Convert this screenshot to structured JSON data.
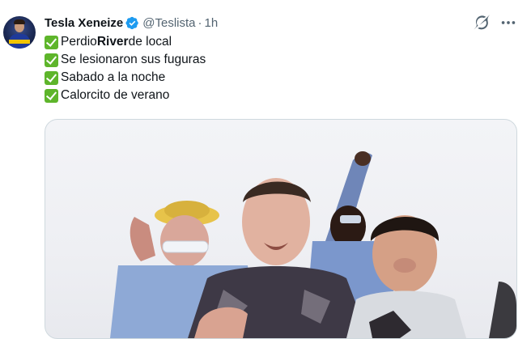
{
  "tweet": {
    "author_name": "Tesla Xeneize",
    "handle": "@Teslista",
    "separator": "·",
    "time": "1h",
    "lines": [
      {
        "before": "Perdio ",
        "bold": "River",
        "after": " de local"
      },
      {
        "before": "Se lesionaron sus fuguras",
        "bold": "",
        "after": ""
      },
      {
        "before": "Sabado a la noche",
        "bold": "",
        "after": ""
      },
      {
        "before": "Calorcito de verano",
        "bold": "",
        "after": ""
      }
    ]
  },
  "icons": {
    "verified": "verified-badge-icon",
    "check": "check-mark-button-emoji",
    "grok": "grok-icon",
    "more": "more-options-icon"
  },
  "colors": {
    "verified_blue": "#1d9bf0",
    "check_green": "#5eb52b",
    "secondary_text": "#536471"
  }
}
